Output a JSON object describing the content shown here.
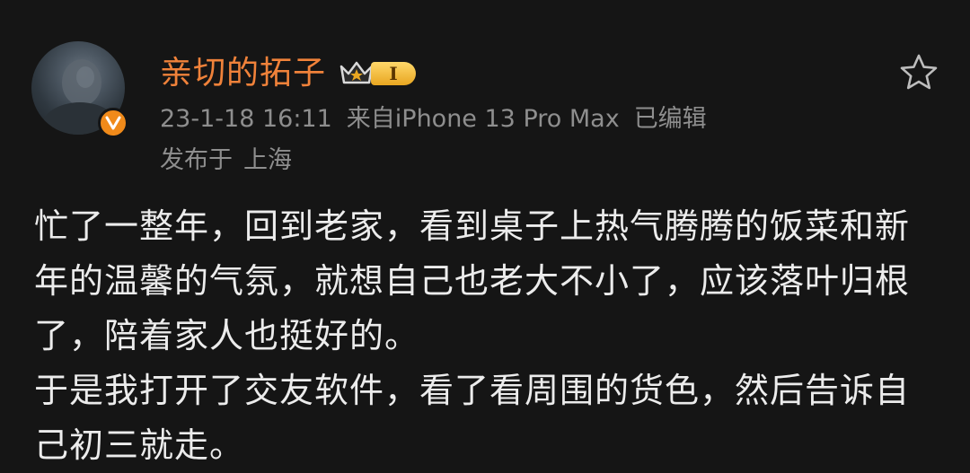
{
  "post": {
    "author": {
      "name": "亲切的拓子",
      "level_label": "I",
      "avatar": "user-avatar",
      "verified_icon": "verified-v-icon"
    },
    "meta": {
      "timestamp": "23-1-18 16:11",
      "source": "来自iPhone 13 Pro Max",
      "edited": "已编辑"
    },
    "location": {
      "prefix": "发布于",
      "city": "上海"
    },
    "actions": {
      "favorite_icon": "star-outline-icon"
    },
    "body": {
      "paragraph_1": "忙了一整年，回到老家，看到桌子上热气腾腾的饭菜和新年的温馨的气氛，就想自己也老大不小了，应该落叶归根了，陪着家人也挺好的。",
      "paragraph_2": "于是我打开了交友软件，看了看周围的货色，然后告诉自己初三就走。"
    }
  },
  "colors": {
    "background": "#151515",
    "username": "#f0823a",
    "meta_text": "#8e8e8e",
    "body_text": "#ececec",
    "badge_orange": "#f08a1a",
    "level_gold": "#e8a621"
  }
}
